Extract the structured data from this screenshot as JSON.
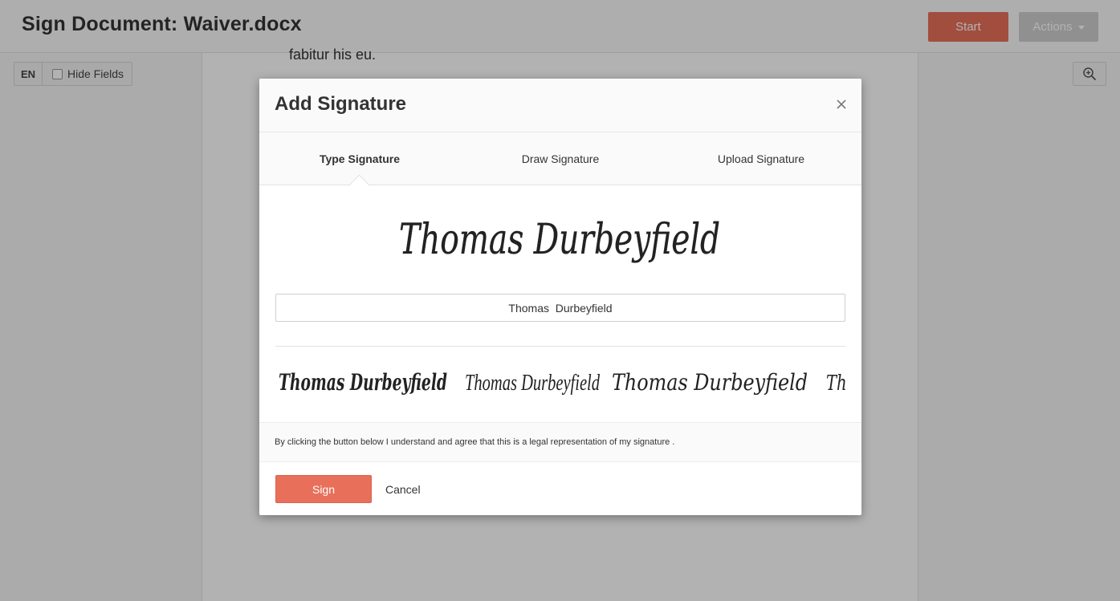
{
  "app": {
    "title": "Sign Document: Waiver.docx",
    "start_label": "Start",
    "actions_label": "Actions",
    "lang_label": "EN",
    "hide_fields_label": "Hide Fields",
    "doc_text": "fabitur his eu."
  },
  "colors": {
    "accent": "#e8705a",
    "actions_bg": "#cfcfcf"
  },
  "icons": {
    "zoom": "zoom-in-icon",
    "close": "close-icon",
    "caret": "caret-down-icon"
  },
  "modal": {
    "title": "Add Signature",
    "tabs": [
      {
        "label": "Type Signature",
        "active": true
      },
      {
        "label": "Draw Signature",
        "active": false
      },
      {
        "label": "Upload Signature",
        "active": false
      }
    ],
    "typed_name": "Thomas  Durbeyfield",
    "signature_preview_text": "Thomas Durbeyfield",
    "style_options": [
      "Thomas Durbeyfield",
      "Thomas Durbeyfield",
      "Thomas Durbeyfield",
      "Thomas Durbeyfield"
    ],
    "legal_text": "By clicking the button below I understand and agree that this is a legal representation of my signature .",
    "sign_label": "Sign",
    "cancel_label": "Cancel"
  }
}
